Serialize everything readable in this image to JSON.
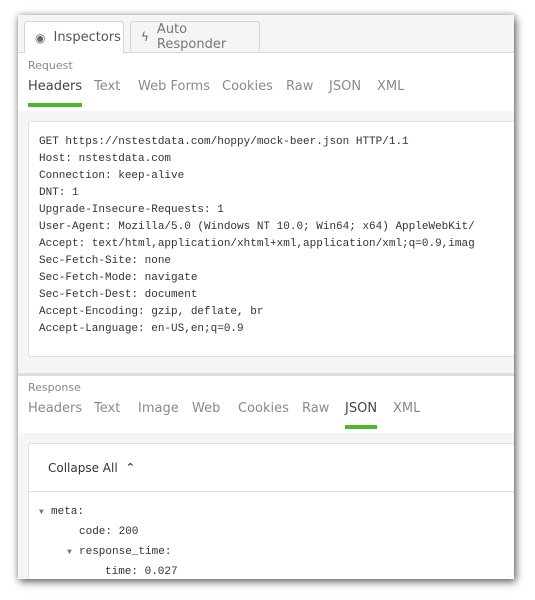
{
  "top_tabs": [
    {
      "label": "Inspectors",
      "icon": "eye-icon",
      "active": true
    },
    {
      "label": "Auto Responder",
      "icon": "lightning-icon",
      "active": false
    }
  ],
  "request": {
    "label": "Request",
    "tabs": [
      "Headers",
      "Text",
      "Web Forms",
      "Cookies",
      "Raw",
      "JSON",
      "XML"
    ],
    "active_tab": "Headers",
    "lines": [
      "GET https://nstestdata.com/hoppy/mock-beer.json HTTP/1.1",
      "Host: nstestdata.com",
      "Connection: keep-alive",
      "DNT: 1",
      "Upgrade-Insecure-Requests: 1",
      "User-Agent: Mozilla/5.0 (Windows NT 10.0; Win64; x64) AppleWebKit/",
      "Accept: text/html,application/xhtml+xml,application/xml;q=0.9,imag",
      "Sec-Fetch-Site: none",
      "Sec-Fetch-Mode: navigate",
      "Sec-Fetch-Dest: document",
      "Accept-Encoding: gzip, deflate, br",
      "Accept-Language: en-US,en;q=0.9"
    ]
  },
  "response": {
    "label": "Response",
    "tabs": [
      "Headers",
      "Text",
      "Image",
      "Web",
      "Cookies",
      "Raw",
      "JSON",
      "XML"
    ],
    "active_tab": "JSON",
    "collapse_label": "Collapse All",
    "tree": [
      {
        "text": "meta:",
        "expandable": true
      },
      {
        "text": "code: 200",
        "expandable": false
      },
      {
        "text": "response_time:",
        "expandable": true
      },
      {
        "text": "time: 0.027",
        "expandable": false
      }
    ]
  },
  "colors": {
    "accent": "#4cba26"
  }
}
